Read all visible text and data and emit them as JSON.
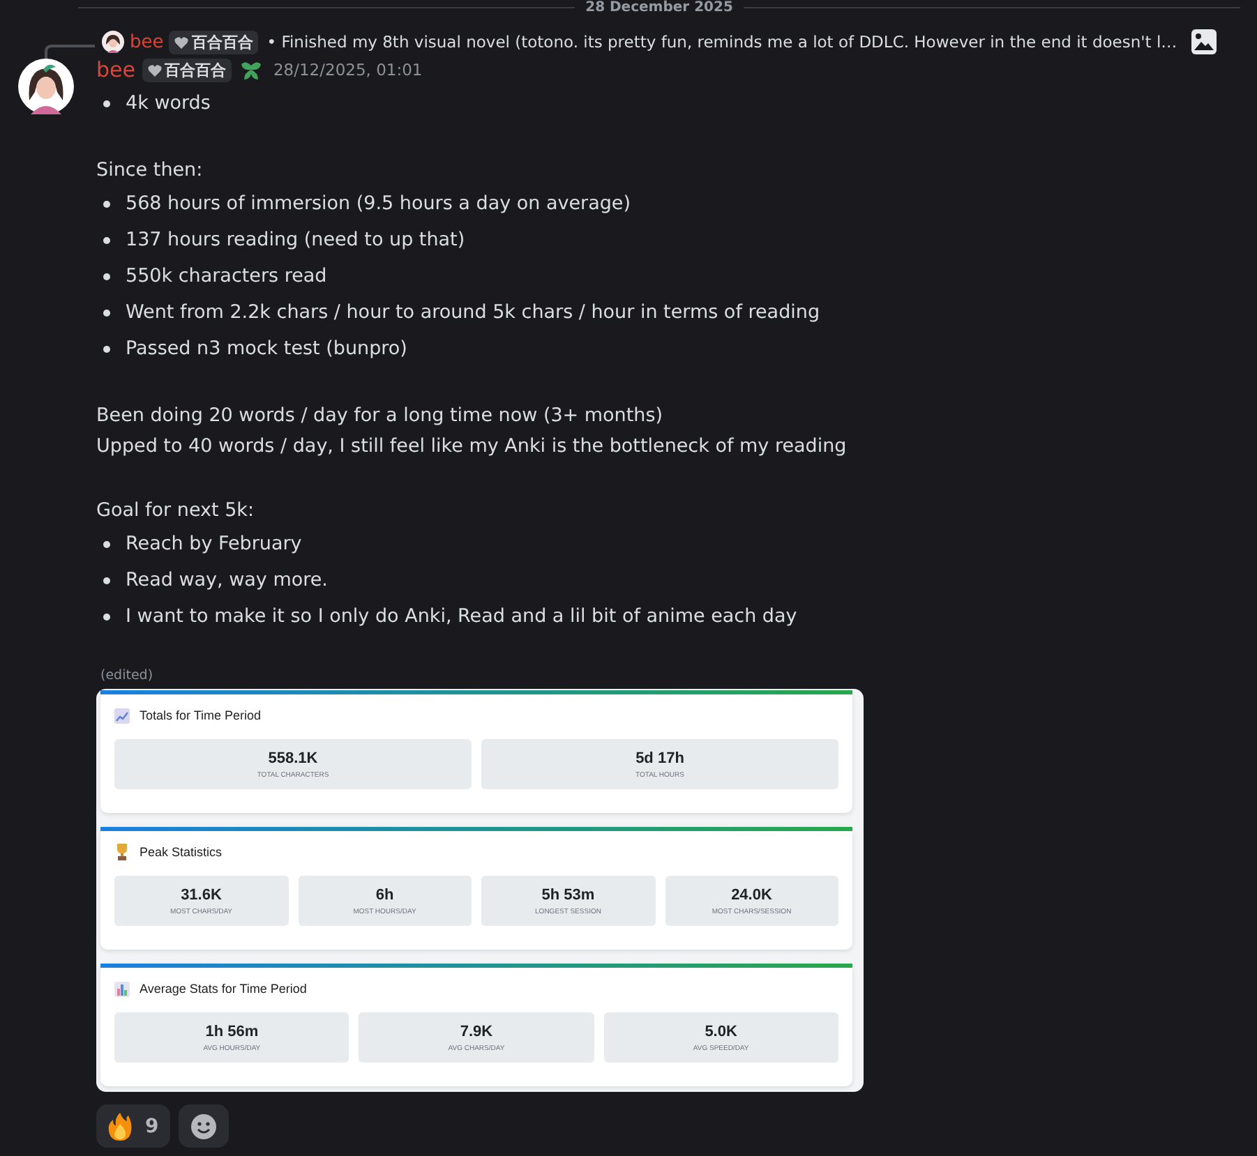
{
  "divider": "28 December 2025",
  "reply": {
    "author": "bee",
    "tag": "百合百合",
    "text": "• Finished my 8th visual novel (totono. its pretty fun, reminds me a lot of DDLC. However in the end it doesn't l…"
  },
  "message": {
    "author": "bee",
    "tag": "百合百合",
    "timestamp": "28/12/2025, 01:01",
    "paragraphs": [
      {
        "items": [
          {
            "kind": "bullet",
            "text": "4k words"
          }
        ]
      },
      {
        "items": [
          {
            "kind": "line",
            "text": "Since then:"
          },
          {
            "kind": "bullet",
            "text": "568 hours of immersion (9.5 hours a day on average)"
          },
          {
            "kind": "bullet",
            "text": "137 hours reading (need to up that)"
          },
          {
            "kind": "bullet",
            "text": "550k characters read"
          },
          {
            "kind": "bullet",
            "text": "Went from 2.2k chars / hour to around 5k chars / hour in terms of reading"
          },
          {
            "kind": "bullet",
            "text": "Passed n3 mock test (bunpro)"
          }
        ]
      },
      {
        "items": [
          {
            "kind": "line",
            "text": "Been doing 20 words / day for a long time now (3+ months)"
          },
          {
            "kind": "line",
            "text": "Upped to 40 words / day, I still feel like my Anki is the bottleneck of my reading"
          }
        ]
      },
      {
        "items": [
          {
            "kind": "line",
            "text": "Goal for next 5k:"
          },
          {
            "kind": "bullet",
            "text": "Reach by February"
          },
          {
            "kind": "bullet",
            "text": "Read way, way more."
          },
          {
            "kind": "bullet",
            "text": "I want to make it so I only do Anki, Read and a lil bit of anime each day"
          }
        ]
      }
    ],
    "edited": "(edited)"
  },
  "stats_image": {
    "sections": [
      {
        "title": "Totals for Time Period",
        "tiles": [
          {
            "value": "558.1K",
            "label": "TOTAL CHARACTERS"
          },
          {
            "value": "5d 17h",
            "label": "TOTAL HOURS"
          }
        ]
      },
      {
        "title": "Peak Statistics",
        "tiles": [
          {
            "value": "31.6K",
            "label": "MOST CHARS/DAY"
          },
          {
            "value": "6h",
            "label": "MOST HOURS/DAY"
          },
          {
            "value": "5h 53m",
            "label": "LONGEST SESSION"
          },
          {
            "value": "24.0K",
            "label": "MOST CHARS/SESSION"
          }
        ]
      },
      {
        "title": "Average Stats for Time Period",
        "tiles": [
          {
            "value": "1h 56m",
            "label": "AVG HOURS/DAY"
          },
          {
            "value": "7.9K",
            "label": "AVG CHARS/DAY"
          },
          {
            "value": "5.0K",
            "label": "AVG SPEED/DAY"
          }
        ]
      }
    ]
  },
  "reactions": [
    {
      "count": "9"
    }
  ]
}
